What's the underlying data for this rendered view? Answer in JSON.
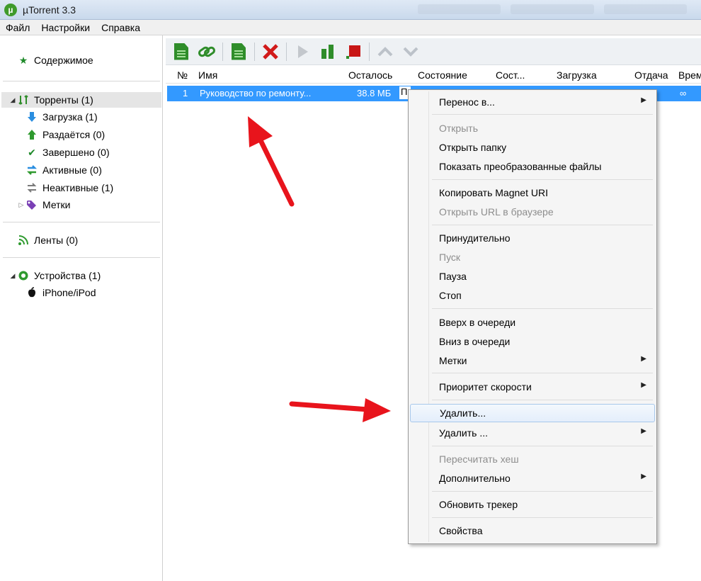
{
  "window": {
    "title": "µTorrent 3.3",
    "logo_glyph": "µ"
  },
  "menubar": {
    "items": [
      "Файл",
      "Настройки",
      "Справка"
    ]
  },
  "sidebar": {
    "content_label": "Содержимое",
    "torrents": {
      "label": "Торренты (1)",
      "children": [
        "Загрузка (1)",
        "Раздаётся (0)",
        "Завершено (0)",
        "Активные (0)",
        "Неактивные (1)",
        "Метки"
      ]
    },
    "feeds_label": "Ленты (0)",
    "devices": {
      "label": "Устройства (1)",
      "children": [
        "iPhone/iPod"
      ]
    }
  },
  "columns": [
    "№",
    "Имя",
    "Осталось",
    "Состояние",
    "Сост...",
    "Загрузка",
    "Отдача",
    "Врем"
  ],
  "torrent_row": {
    "num": "1",
    "name": "Руководство по ремонту...",
    "remaining": "38.8 МБ",
    "state": "П",
    "eta": "∞"
  },
  "context_menu": {
    "items": [
      {
        "label": "Перенос в...",
        "submenu": true
      },
      {
        "label": "Открыть",
        "disabled": true
      },
      {
        "label": "Открыть папку"
      },
      {
        "label": "Показать преобразованные файлы"
      },
      {
        "label": "Копировать Magnet URI"
      },
      {
        "label": "Открыть URL в браузере",
        "disabled": true
      },
      {
        "label": "Принудительно"
      },
      {
        "label": "Пуск",
        "disabled": true
      },
      {
        "label": "Пауза"
      },
      {
        "label": "Стоп"
      },
      {
        "label": "Вверх в очереди"
      },
      {
        "label": "Вниз в очереди"
      },
      {
        "label": "Метки",
        "submenu": true
      },
      {
        "label": "Приоритет скорости",
        "submenu": true
      },
      {
        "label": "Удалить...",
        "hover": true
      },
      {
        "label": "Удалить ...",
        "submenu": true
      },
      {
        "label": "Пересчитать хеш",
        "disabled": true
      },
      {
        "label": "Дополнительно",
        "submenu": true
      },
      {
        "label": "Обновить трекер"
      },
      {
        "label": "Свойства"
      }
    ]
  },
  "colors": {
    "selection": "#3399ff",
    "annotation_arrow": "#e8141c",
    "brand_green": "#3f9a2b"
  }
}
